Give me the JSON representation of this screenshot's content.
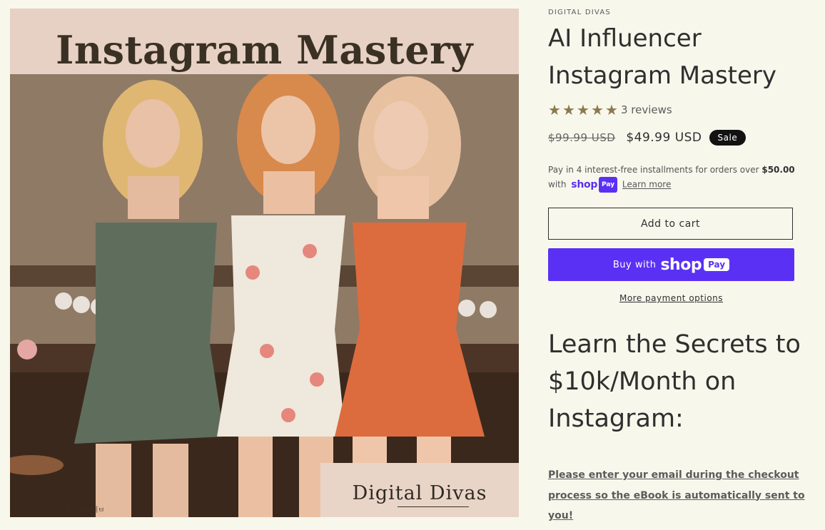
{
  "product_image": {
    "banner_title": "Instagram Mastery",
    "brand_mark": "Digital Divas",
    "watermark": "ㅅ흠ㅋ짜ㅂ에ㅂ"
  },
  "product": {
    "vendor": "DIGITAL DIVAS",
    "title": "AI Influencer Instagram Mastery",
    "rating": 5,
    "reviews_label": "3 reviews",
    "price_original": "$99.99 USD",
    "price_sale": "$49.99 USD",
    "sale_badge": "Sale"
  },
  "installments": {
    "text_before": "Pay in 4 interest-free installments for orders over ",
    "threshold": "$50.00",
    "with_text": "with",
    "shoppay_word": "shop",
    "shoppay_pill": "Pay",
    "learn_more": "Learn more"
  },
  "actions": {
    "add_to_cart": "Add to cart",
    "buy_with": "Buy with",
    "shoppay_logo": "shop",
    "shoppay_pay": "Pay",
    "more_payment_options": "More payment options"
  },
  "description": {
    "headline": "Learn the Secrets to $10k/Month on Instagram:",
    "notice": "Please enter your email during the checkout process so the eBook is automatically sent to you!"
  },
  "colors": {
    "background": "#f8f7ec",
    "shop_pay": "#5a31f4",
    "star": "#8a7a4e",
    "sale_badge": "#121212"
  },
  "icons": [
    "star-icon"
  ]
}
